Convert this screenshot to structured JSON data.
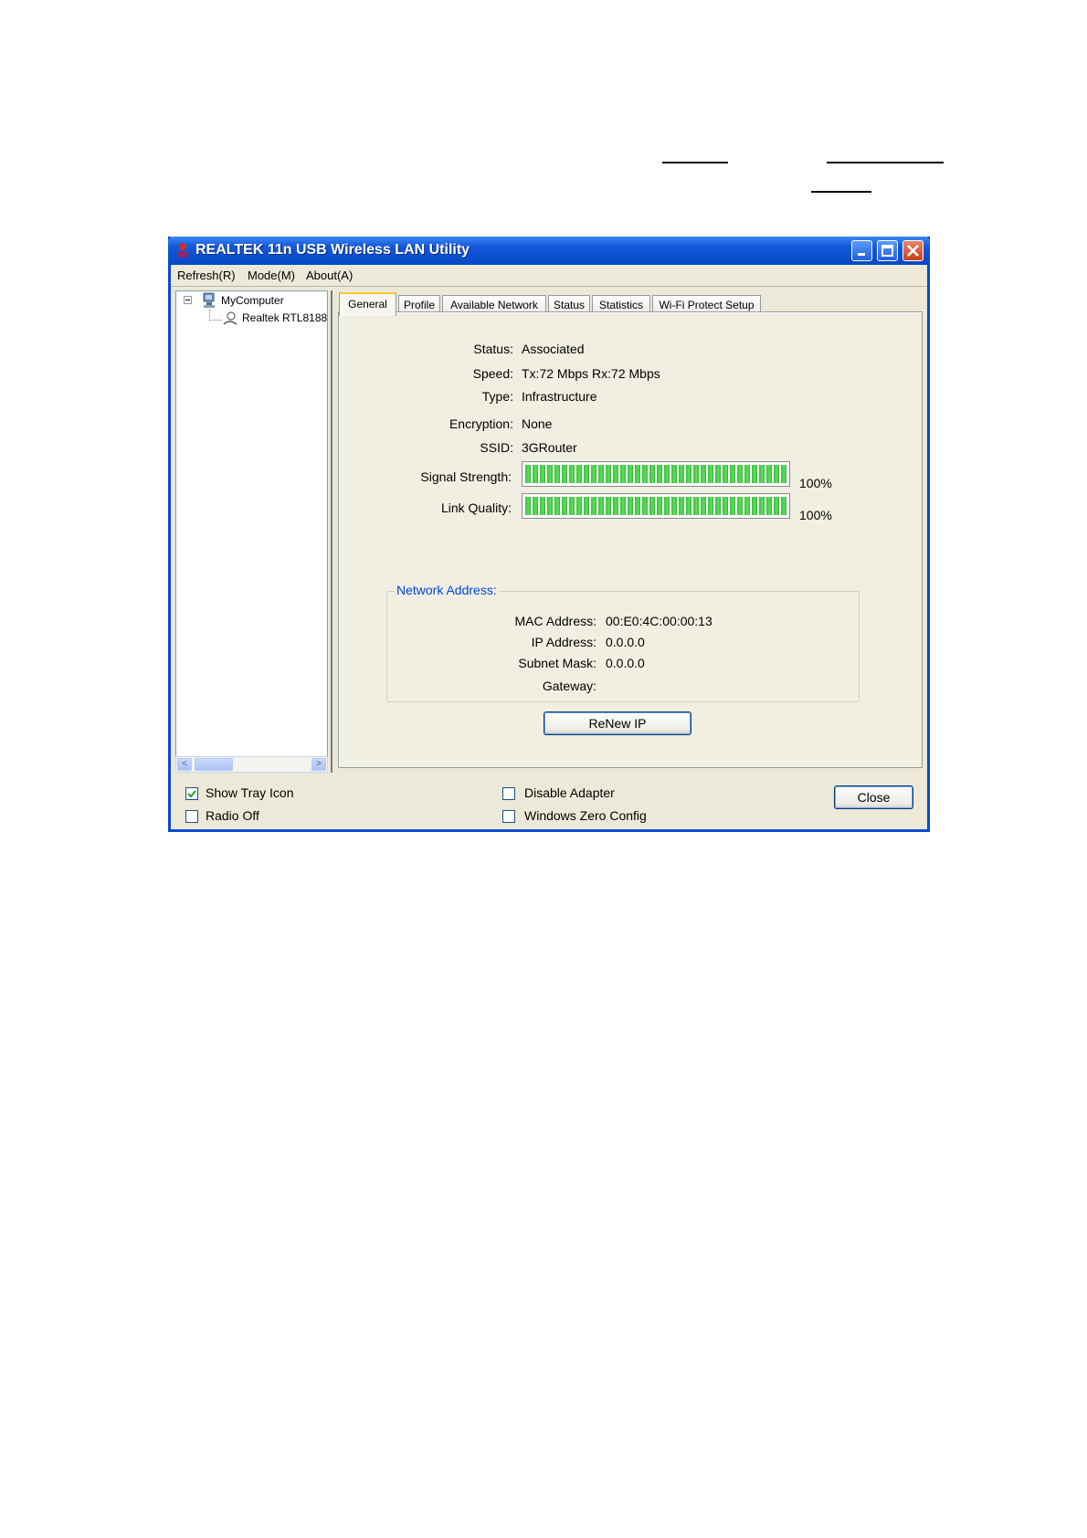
{
  "window": {
    "title": "REALTEK 11n USB Wireless LAN Utility"
  },
  "menu": {
    "items": [
      "Refresh(R)",
      "Mode(M)",
      "About(A)"
    ]
  },
  "tree": {
    "root": "MyComputer",
    "child": "Realtek RTL8188"
  },
  "tabs": [
    "General",
    "Profile",
    "Available Network",
    "Status",
    "Statistics",
    "Wi-Fi Protect Setup"
  ],
  "general": {
    "status_label": "Status:",
    "status_value": "Associated",
    "speed_label": "Speed:",
    "speed_value": "Tx:72 Mbps Rx:72 Mbps",
    "type_label": "Type:",
    "type_value": "Infrastructure",
    "encryption_label": "Encryption:",
    "encryption_value": "None",
    "ssid_label": "SSID:",
    "ssid_value": "3GRouter",
    "signal_label": "Signal Strength:",
    "signal_pct": "100%",
    "signal_level": 1.0,
    "link_label": "Link Quality:",
    "link_pct": "100%",
    "link_level": 1.0
  },
  "network": {
    "title": "Network Address:",
    "mac_label": "MAC Address:",
    "mac_value": "00:E0:4C:00:00:13",
    "ip_label": "IP Address:",
    "ip_value": "0.0.0.0",
    "subnet_label": "Subnet Mask:",
    "subnet_value": "0.0.0.0",
    "gateway_label": "Gateway:",
    "gateway_value": ""
  },
  "buttons": {
    "renew": "ReNew IP",
    "close": "Close"
  },
  "options": {
    "show_tray_icon": {
      "label": "Show Tray Icon",
      "checked": true
    },
    "radio_off": {
      "label": "Radio Off",
      "checked": false
    },
    "disable_adapter": {
      "label": "Disable Adapter",
      "checked": false
    },
    "windows_zero_config": {
      "label": "Windows Zero Config",
      "checked": false
    }
  },
  "colors": {
    "titlebar": "#0b4fd0",
    "window_bg": "#ece9d8",
    "bar_green": "#3cc43c",
    "group_title": "#0046d5"
  }
}
